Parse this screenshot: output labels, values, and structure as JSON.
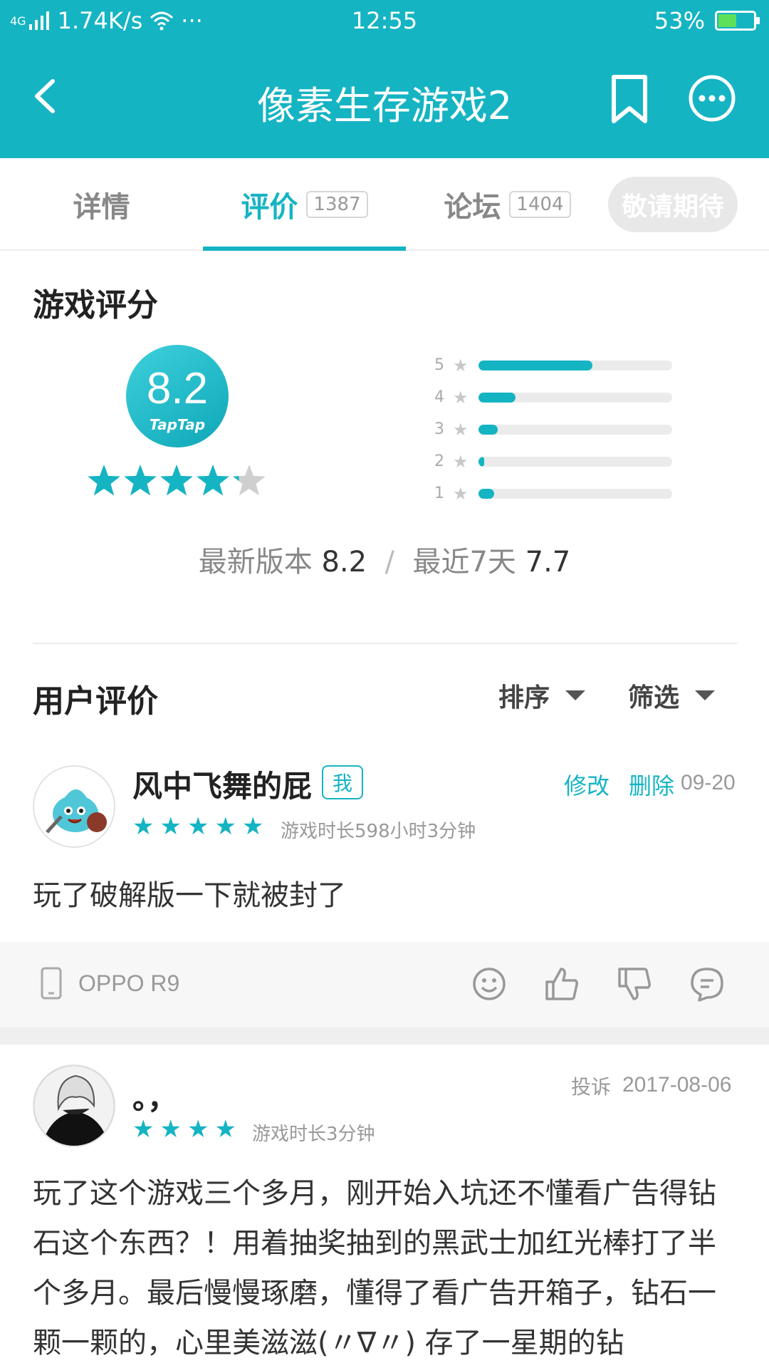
{
  "status_bar": {
    "network": "4G",
    "speed": "1.74K/s",
    "dots": "···",
    "time": "12:55",
    "battery": "53%",
    "battery_level": 0.53
  },
  "header": {
    "title": "像素生存游戏2"
  },
  "tabs": [
    {
      "label": "详情"
    },
    {
      "label": "评价",
      "count": "1387"
    },
    {
      "label": "论坛",
      "count": "1404"
    }
  ],
  "follow_button": "敬请期待",
  "rating": {
    "section_title": "游戏评分",
    "score": "8.2",
    "brand": "TapTap",
    "stars": 4.2,
    "distribution": [
      {
        "label": "5",
        "fraction": 0.59
      },
      {
        "label": "4",
        "fraction": 0.19
      },
      {
        "label": "3",
        "fraction": 0.1
      },
      {
        "label": "2",
        "fraction": 0.03
      },
      {
        "label": "1",
        "fraction": 0.08
      }
    ],
    "latest_label": "最新版本",
    "latest_value": "8.2",
    "separator": "/",
    "recent_label": "最近7天",
    "recent_value": "7.7"
  },
  "user_reviews": {
    "section_title": "用户评价",
    "sort_label": "排序",
    "filter_label": "筛选"
  },
  "reviews": [
    {
      "username": "风中飞舞的屁",
      "badge": "我",
      "stars": 5,
      "playtime": "游戏时长598小时3分钟",
      "edit": "修改",
      "delete": "删除",
      "date": "09-20",
      "text": "玩了破解版一下就被封了",
      "device": "OPPO R9"
    },
    {
      "username": "。，",
      "stars": 4,
      "playtime": "游戏时长3分钟",
      "report": "投诉",
      "date": "2017-08-06",
      "text": "玩了这个游戏三个多月，刚开始入坑还不懂看广告得钻石这个东西？！用着抽奖抽到的黑武士加红光棒打了半个多月。最后慢慢琢磨，懂得了看广告开箱子，钻石一颗一颗的，心里美滋滋(〃∇〃) 存了一星期的钻"
    }
  ],
  "colors": {
    "accent": "#15b4c3",
    "header_bg": "#15b4c3"
  }
}
